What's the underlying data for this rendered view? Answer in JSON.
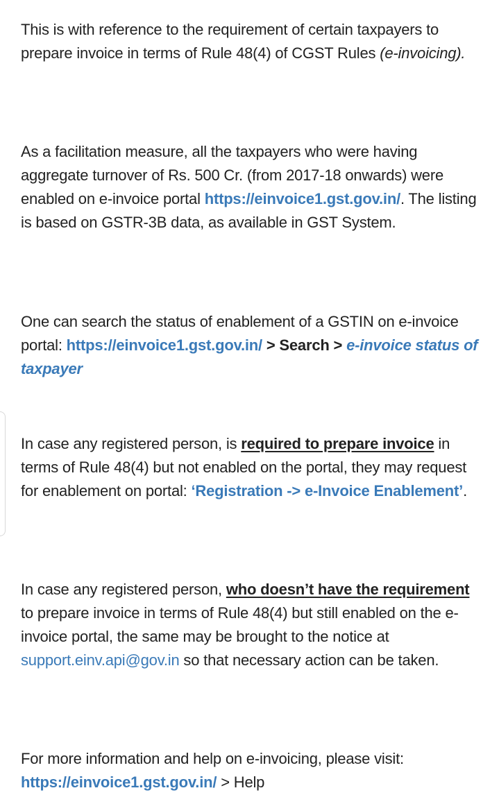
{
  "paragraphs": {
    "p1": {
      "text1": "This is with reference to the requirement of certain taxpayers to prepare invoice in terms of Rule 48(4) of CGST Rules ",
      "italic": "(e-invoicing)."
    },
    "p2": {
      "text1": "As a facilitation measure, all the taxpayers who were having aggregate turnover of Rs. 500 Cr. (from 2017-18 onwards) were enabled on e-invoice portal ",
      "link": "https://einvoice1.gst.gov.in/",
      "text2": ". The listing is based on GSTR-3B data, as available in GST System."
    },
    "p3": {
      "text1": "One can search the status of enablement of a GSTIN on e-invoice portal: ",
      "link": "https://einvoice1.gst.gov.in/",
      "bold": " > Search > ",
      "italic_link": "e-invoice status of taxpayer"
    },
    "p4": {
      "text1": "In case any registered person, is ",
      "bold_underline": "required to prepare invoice",
      "text2": " in terms of Rule 48(4) but not enabled on the portal, they may request for enablement on portal: ",
      "bold_link": "‘Registration -> e-Invoice Enablement’",
      "text3": "."
    },
    "p5": {
      "text1": "In case any registered person, ",
      "bold_underline": "who doesn’t have the requirement",
      "text2": " to prepare invoice in terms of Rule 48(4) but still enabled on the e-invoice portal, the same may be brought to the notice at ",
      "email_link": "support.einv.api@gov.in",
      "text3": " so that necessary action can be taken."
    },
    "p6": {
      "text1": "For more information and help on e-invoicing, please visit: ",
      "link": "https://einvoice1.gst.gov.in/",
      "text2": " > Help"
    }
  },
  "colors": {
    "text": "#222222",
    "link": "#3a7ab8",
    "background": "#ffffff"
  }
}
